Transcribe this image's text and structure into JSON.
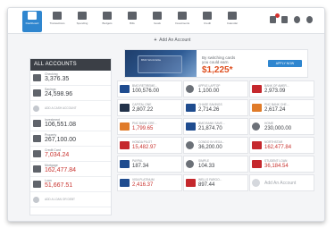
{
  "nav": {
    "items": [
      {
        "label": "Dashboard",
        "icon": "briefcase-icon"
      },
      {
        "label": "Transactions",
        "icon": "list-icon"
      },
      {
        "label": "Spending",
        "icon": "pie-icon"
      },
      {
        "label": "Budgets",
        "icon": "budget-icon"
      },
      {
        "label": "Bills",
        "icon": "clock-icon"
      },
      {
        "label": "Goals",
        "icon": "trophy-icon"
      },
      {
        "label": "Investments",
        "icon": "chart-icon"
      },
      {
        "label": "Credit",
        "icon": "gauge-icon"
      },
      {
        "label": "Calendar",
        "icon": "calendar-icon"
      }
    ],
    "active": "Dashboard",
    "right_icons": [
      "notifications-icon",
      "bank-icon",
      "gear-icon",
      "help-icon"
    ]
  },
  "add_account_label": "Add An Account",
  "banner": {
    "card_label": "BMO World Elite",
    "line1": "By switching cards",
    "line2": "you could earn",
    "amount": "$1,225*",
    "button": "APPLY NOW"
  },
  "sidebar": {
    "header": "ALL ACCOUNTS",
    "rows": [
      {
        "name": "Checking",
        "amount": "3,376.35",
        "negative": false,
        "link": false
      },
      {
        "name": "Savings",
        "amount": "24,598.96",
        "negative": false,
        "link": false
      },
      {
        "name": "ADD A CASH ACCOUNT",
        "amount": "",
        "negative": false,
        "link": true
      },
      {
        "name": "Investment",
        "amount": "106,551.08",
        "negative": false,
        "link": false
      },
      {
        "name": "Property",
        "amount": "267,100.00",
        "negative": false,
        "link": false
      },
      {
        "name": "Credit Card",
        "amount": "7,034.24",
        "negative": true,
        "link": false
      },
      {
        "name": "Mortgage",
        "amount": "162,477.84",
        "negative": true,
        "link": false
      },
      {
        "name": "Loan",
        "amount": "51,667.51",
        "negative": true,
        "link": false
      },
      {
        "name": "ADD A LOAN OR DEBT",
        "amount": "",
        "negative": false,
        "link": true
      }
    ]
  },
  "tiles": [
    {
      "name": "BMO RETIREME...",
      "amount": "100,576.00",
      "negative": false,
      "logo": "blue"
    },
    {
      "name": "APPLE LAPTOP",
      "amount": "1,100.00",
      "negative": false,
      "logo": "grey"
    },
    {
      "name": "BANK OF AMER...",
      "amount": "2,973.09",
      "negative": false,
      "logo": "red"
    },
    {
      "name": "CAPITAL ONE",
      "amount": "2,807.22",
      "negative": false,
      "logo": "dark"
    },
    {
      "name": "CHASE SAVINGS",
      "amount": "2,714.26",
      "negative": false,
      "logo": "blue"
    },
    {
      "name": "PNC BANK CHE...",
      "amount": "2,617.24",
      "negative": false,
      "logo": "orange"
    },
    {
      "name": "PNC BANK CRE...",
      "amount": "1,799.65",
      "negative": true,
      "logo": "orange"
    },
    {
      "name": "BMO BANK SAVE...",
      "amount": "21,874.70",
      "negative": false,
      "logo": "blue"
    },
    {
      "name": "HOME",
      "amount": "230,000.00",
      "negative": false,
      "logo": "grey"
    },
    {
      "name": "HONDA PILOT",
      "amount": "15,482.97",
      "negative": true,
      "logo": "red"
    },
    {
      "name": "CONDO IN VEGA...",
      "amount": "36,200.00",
      "negative": false,
      "logo": "grey"
    },
    {
      "name": "NORTHSTAR",
      "amount": "162,477.84",
      "negative": true,
      "logo": "red"
    },
    {
      "name": "PAYPAL",
      "amount": "187.34",
      "negative": false,
      "logo": "blue"
    },
    {
      "name": "SIMPLE",
      "amount": "104.33",
      "negative": false,
      "logo": "grey"
    },
    {
      "name": "STUDENT LOAN",
      "amount": "36,184.54",
      "negative": true,
      "logo": "red"
    },
    {
      "name": "VISA PLATINUM",
      "amount": "2,416.37",
      "negative": true,
      "logo": "blue"
    },
    {
      "name": "WELLS FARGO...",
      "amount": "897.44",
      "negative": false,
      "logo": "red"
    },
    {
      "name": "Add An Account",
      "amount": "",
      "negative": false,
      "logo": "plus",
      "add": true
    }
  ],
  "colors": {
    "accent": "#2f86cf",
    "negative": "#c8332f",
    "promo": "#de4f20",
    "header": "#3b3f46"
  }
}
